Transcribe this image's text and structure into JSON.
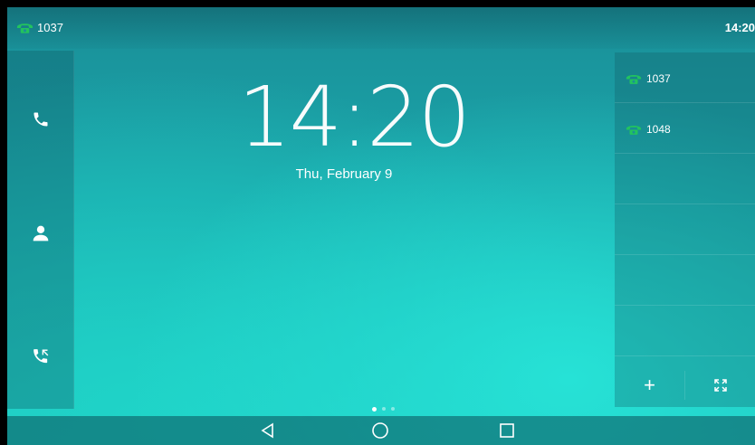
{
  "statusbar": {
    "account": "1037",
    "account_icon": "phone-handset-icon",
    "time": "14:20"
  },
  "sidebar": {
    "items": [
      {
        "name": "dialer",
        "icon": "phone-icon"
      },
      {
        "name": "directory",
        "icon": "contact-icon"
      },
      {
        "name": "history",
        "icon": "call-history-icon"
      }
    ]
  },
  "idle": {
    "time": "14:20",
    "date": "Thu, February 9"
  },
  "accounts_panel": {
    "accounts": [
      {
        "label": "1037",
        "status_color": "#22c35e"
      },
      {
        "label": "1048",
        "status_color": "#22c35e"
      }
    ],
    "buttons": {
      "add": "+",
      "expand": "expand-icon"
    }
  },
  "pager": {
    "pages": 3,
    "current": 1
  },
  "navbar": {
    "back": "back-icon",
    "home": "home-icon",
    "recent": "recent-apps-icon"
  },
  "colors": {
    "accent_green": "#22c35e",
    "background": "#1ba7ab"
  }
}
